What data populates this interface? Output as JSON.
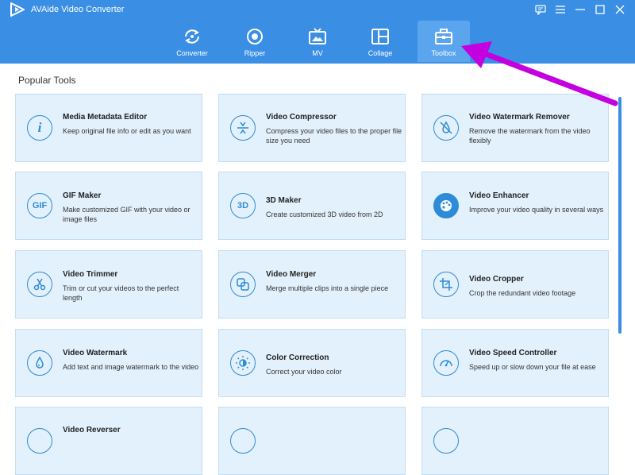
{
  "app": {
    "title": "AVAide Video Converter"
  },
  "nav": [
    {
      "label": "Converter",
      "icon": "converter-icon"
    },
    {
      "label": "Ripper",
      "icon": "ripper-icon"
    },
    {
      "label": "MV",
      "icon": "mv-icon"
    },
    {
      "label": "Collage",
      "icon": "collage-icon"
    },
    {
      "label": "Toolbox",
      "icon": "toolbox-icon",
      "active": true
    }
  ],
  "section_title": "Popular Tools",
  "tools": [
    {
      "title": "Media Metadata Editor",
      "desc": "Keep original file info or edit as you want",
      "icon": "info-icon"
    },
    {
      "title": "Video Compressor",
      "desc": "Compress your video files to the proper file size you need",
      "icon": "compress-icon"
    },
    {
      "title": "Video Watermark Remover",
      "desc": "Remove the watermark from the video flexibly",
      "icon": "watermark-remove-icon"
    },
    {
      "title": "GIF Maker",
      "desc": "Make customized GIF with your video or image files",
      "icon": "gif-icon",
      "glyph": "GIF"
    },
    {
      "title": "3D Maker",
      "desc": "Create customized 3D video from 2D",
      "icon": "3d-icon",
      "glyph": "3D"
    },
    {
      "title": "Video Enhancer",
      "desc": "Improve your video quality in several ways",
      "icon": "palette-icon"
    },
    {
      "title": "Video Trimmer",
      "desc": "Trim or cut your videos to the perfect length",
      "icon": "scissors-icon"
    },
    {
      "title": "Video Merger",
      "desc": "Merge multiple clips into a single piece",
      "icon": "merge-icon"
    },
    {
      "title": "Video Cropper",
      "desc": "Crop the redundant video footage",
      "icon": "crop-icon"
    },
    {
      "title": "Video Watermark",
      "desc": "Add text and image watermark to the video",
      "icon": "watermark-icon"
    },
    {
      "title": "Color Correction",
      "desc": "Correct your video color",
      "icon": "color-correction-icon"
    },
    {
      "title": "Video Speed Controller",
      "desc": "Speed up or slow down your file at ease",
      "icon": "speedometer-icon"
    },
    {
      "title": "Video Reverser",
      "desc": "",
      "icon": "reverse-icon"
    },
    {
      "title": "",
      "desc": "",
      "icon": "rotate-icon"
    },
    {
      "title": "",
      "desc": "",
      "icon": "volume-icon"
    }
  ],
  "colors": {
    "accent": "#3a8fe5",
    "card_bg": "#e3f1fc",
    "arrow": "#c400e0"
  }
}
